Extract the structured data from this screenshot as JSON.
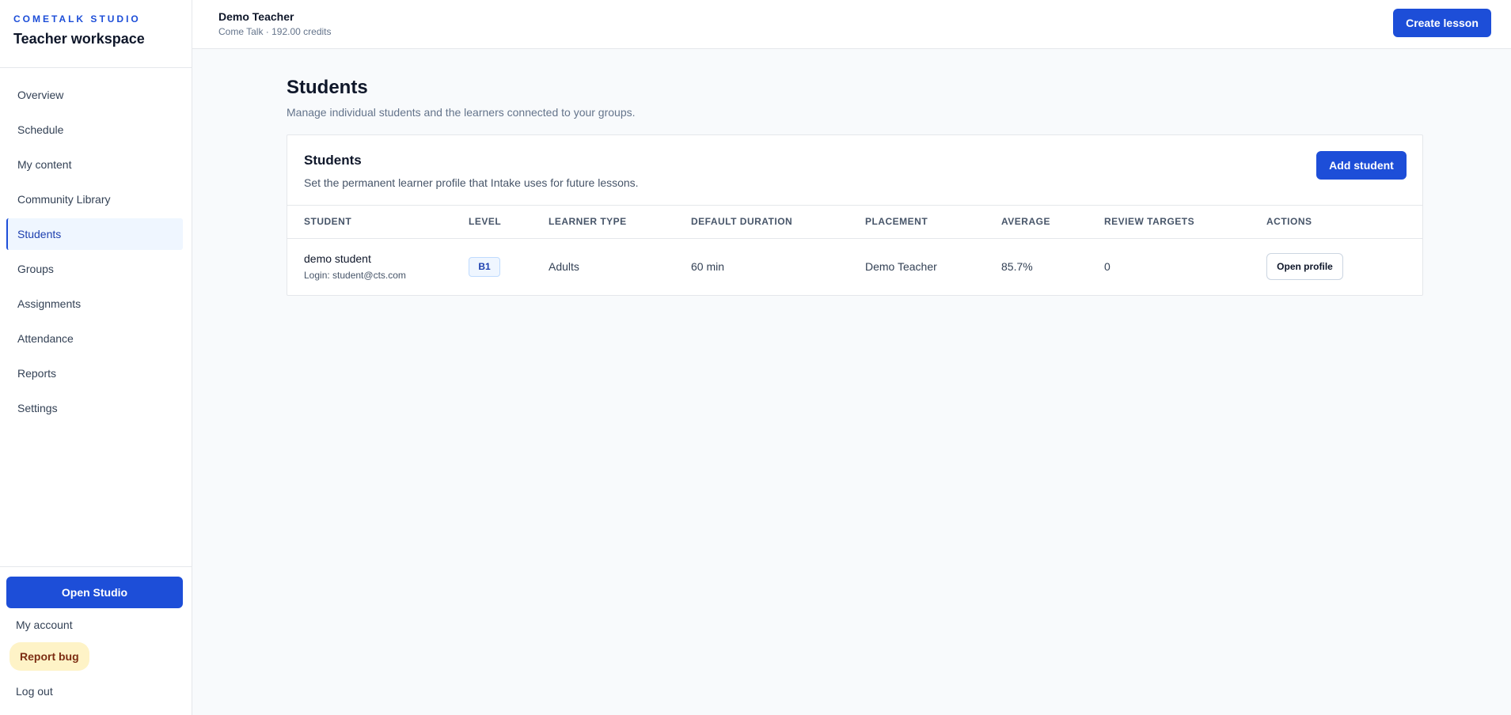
{
  "brand": {
    "kicker": "COMETALK STUDIO",
    "title": "Teacher workspace"
  },
  "nav": {
    "items": [
      {
        "label": "Overview",
        "active": false
      },
      {
        "label": "Schedule",
        "active": false
      },
      {
        "label": "My content",
        "active": false
      },
      {
        "label": "Community Library",
        "active": false
      },
      {
        "label": "Students",
        "active": true
      },
      {
        "label": "Groups",
        "active": false
      },
      {
        "label": "Assignments",
        "active": false
      },
      {
        "label": "Attendance",
        "active": false
      },
      {
        "label": "Reports",
        "active": false
      },
      {
        "label": "Settings",
        "active": false
      }
    ]
  },
  "sidebar_footer": {
    "open_studio_label": "Open Studio",
    "my_account_label": "My account",
    "report_bug_label": "Report bug",
    "log_out_label": "Log out"
  },
  "topbar": {
    "user_name": "Demo Teacher",
    "meta": "Come Talk · 192.00 credits",
    "create_lesson_label": "Create lesson"
  },
  "page": {
    "title": "Students",
    "subtitle": "Manage individual students and the learners connected to your groups."
  },
  "students_card": {
    "title": "Students",
    "description": "Set the permanent learner profile that Intake uses for future lessons.",
    "add_student_label": "Add student",
    "columns": [
      "STUDENT",
      "LEVEL",
      "LEARNER TYPE",
      "DEFAULT DURATION",
      "PLACEMENT",
      "AVERAGE",
      "REVIEW TARGETS",
      "ACTIONS"
    ],
    "rows": [
      {
        "name": "demo student",
        "login": "Login: student@cts.com",
        "level": "B1",
        "learner_type": "Adults",
        "default_duration": "60 min",
        "placement": "Demo Teacher",
        "average": "85.7%",
        "review_targets": "0",
        "action_label": "Open profile"
      }
    ]
  },
  "colors": {
    "accent": "#1d4ed8",
    "active_nav_bg": "#eff6ff",
    "report_bug_bg": "#fef3c7"
  }
}
